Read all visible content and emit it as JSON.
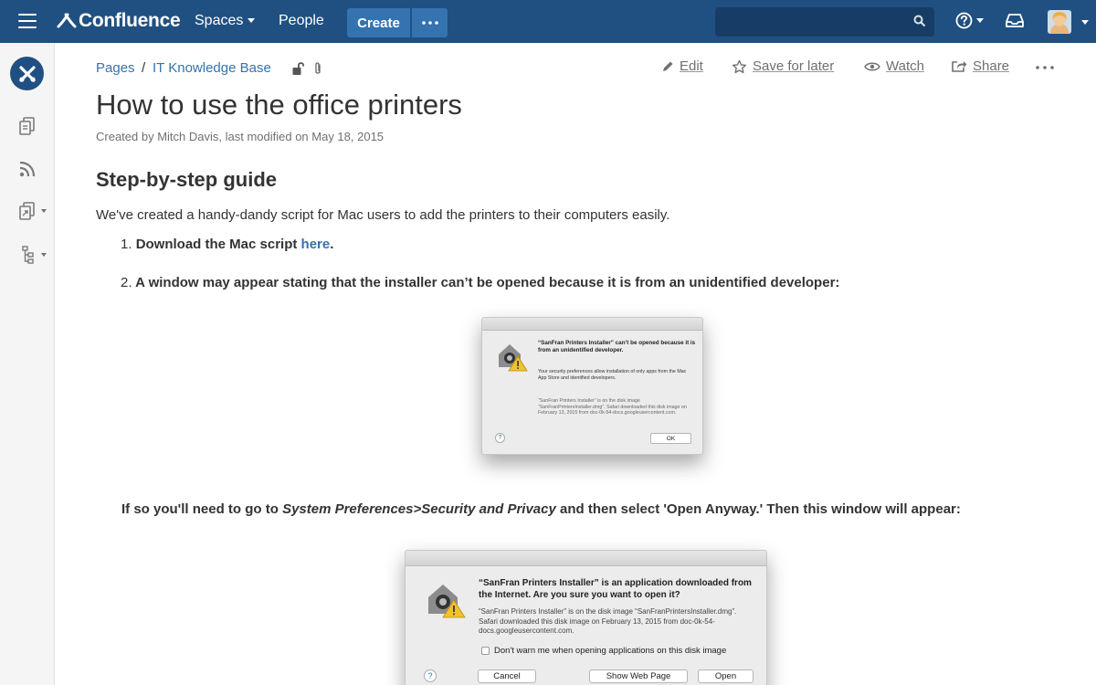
{
  "nav": {
    "product": "Confluence",
    "spaces": "Spaces",
    "people": "People",
    "create": "Create",
    "search_placeholder": "",
    "colors": {
      "bar": "#205081",
      "button": "#3572b0",
      "search": "#173d66"
    }
  },
  "sidebar": {
    "icons": [
      "space-logo-icon",
      "pages-icon",
      "blog-feed-icon",
      "shortcuts-icon",
      "page-tree-icon"
    ]
  },
  "breadcrumb": {
    "items": [
      "Pages",
      "IT Knowledge Base"
    ],
    "separator": "/"
  },
  "actions": {
    "edit": "Edit",
    "save_for_later": "Save for later",
    "watch": "Watch",
    "share": "Share"
  },
  "page": {
    "title": "How to use the office printers",
    "meta": "Created by Mitch Davis, last modified on May 18, 2015",
    "section_heading": "Step-by-step guide",
    "intro": "We've created a handy-dandy script for Mac users to add the printers to their computers easily.",
    "steps": [
      {
        "num": "1.",
        "text": "Download the Mac script ",
        "link": "here",
        "suffix": "."
      },
      {
        "num": "2.",
        "text": "A window may appear stating that the installer can’t be opened because it is from an unidentified developer:"
      }
    ],
    "note": {
      "prefix": "If so you'll need to go to ",
      "italic": "System Preferences>Security and Privacy",
      "suffix": " and then select 'Open Anyway.' Then this window will appear:"
    }
  },
  "dialog1": {
    "title": "“SanFran Printers Installer” can’t be opened because it is from an unidentified developer.",
    "body": "Your security preferences allow installation of only apps from the Mac App Store and identified developers.",
    "detail": "“SanFran Printers Installer” is on the disk image “SanFranPrintersInstaller.dmg”. Safari downloaded this disk image on February 13, 2015 from doc-0k-54-docs.googleusercontent.com.",
    "help": "?",
    "ok": "OK"
  },
  "dialog2": {
    "title": "“SanFran Printers Installer” is an application downloaded from the Internet. Are you sure you want to open it?",
    "body": "“SanFran Printers Installer” is on the disk image “SanFranPrintersInstaller.dmg”. Safari downloaded this disk image on February 13, 2015 from doc-0k-54-docs.googleusercontent.com.",
    "checkbox": "Don't warn me when opening applications on this disk image",
    "help": "?",
    "cancel": "Cancel",
    "show_web_page": "Show Web Page",
    "open": "Open"
  }
}
